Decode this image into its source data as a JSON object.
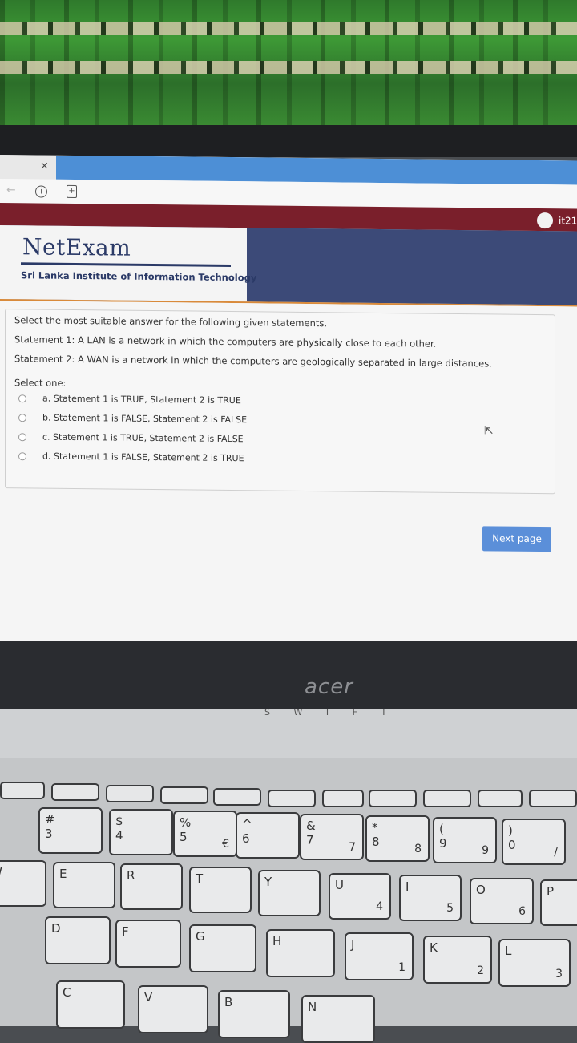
{
  "browser": {
    "tab_close": "×",
    "info_icon": "info-icon",
    "page_icon": "page-icon"
  },
  "header": {
    "user_label": "it21",
    "brand_name": "NetExam",
    "brand_subtitle": "Sri Lanka Institute of Information Technology",
    "colors": {
      "top_bar": "#7a1f2b",
      "banner": "#3c4a78",
      "accent_line": "#d98a3a"
    }
  },
  "question": {
    "lines": [
      "Select the most suitable answer for the following given statements.",
      "Statement 1: A LAN is a network in which the computers are physically close to each other.",
      "Statement 2: A WAN is a network in which the computers are geologically separated in large distances."
    ],
    "select_label": "Select one:",
    "options": [
      "a. Statement 1 is TRUE, Statement 2 is TRUE",
      "b. Statement 1 is FALSE, Statement 2 is FALSE",
      "c. Statement 1 is TRUE, Statement 2 is FALSE",
      "d. Statement 1 is FALSE, Statement 2 is TRUE"
    ]
  },
  "navigation": {
    "next_label": "Next page",
    "button_color": "#5b8fd9"
  },
  "laptop": {
    "logo": "acer",
    "status_letters": [
      "S",
      "W",
      "I",
      "F",
      "T"
    ]
  },
  "keyboard": {
    "row1": [
      {
        "top": "#",
        "bottom": "3"
      },
      {
        "top": "$",
        "bottom": "4"
      },
      {
        "top": "%",
        "bottom": "5",
        "alt": "€"
      },
      {
        "top": "^",
        "bottom": "6"
      },
      {
        "top": "&",
        "bottom": "7",
        "alt": "7"
      },
      {
        "top": "*",
        "bottom": "8",
        "alt": "8"
      },
      {
        "top": "(",
        "bottom": "9",
        "alt": "9"
      },
      {
        "top": ")",
        "bottom": "0",
        "alt": "/"
      }
    ],
    "row2": [
      {
        "top": "W"
      },
      {
        "top": "E"
      },
      {
        "top": "R"
      },
      {
        "top": "T"
      },
      {
        "top": "Y"
      },
      {
        "top": "U",
        "alt": "4"
      },
      {
        "top": "I",
        "alt": "5"
      },
      {
        "top": "O",
        "alt": "6"
      },
      {
        "top": "P"
      }
    ],
    "row3": [
      {
        "top": "D"
      },
      {
        "top": "F"
      },
      {
        "top": "G"
      },
      {
        "top": "H"
      },
      {
        "top": "J",
        "alt": "1"
      },
      {
        "top": "K",
        "alt": "2"
      },
      {
        "top": "L",
        "alt": "3"
      }
    ],
    "row4": [
      {
        "top": "C"
      },
      {
        "top": "V"
      },
      {
        "top": "B"
      },
      {
        "top": "N"
      }
    ]
  }
}
